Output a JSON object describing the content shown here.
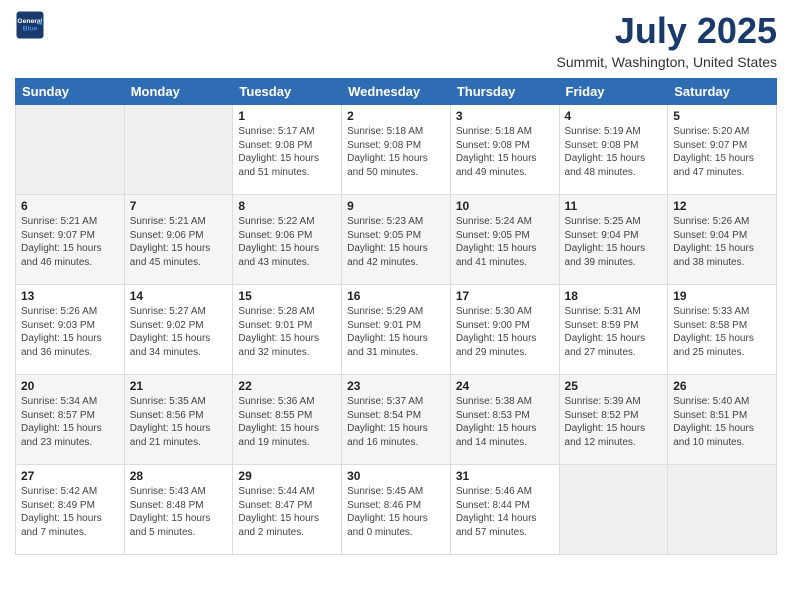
{
  "header": {
    "logo_line1": "General",
    "logo_line2": "Blue",
    "title": "July 2025",
    "subtitle": "Summit, Washington, United States"
  },
  "weekdays": [
    "Sunday",
    "Monday",
    "Tuesday",
    "Wednesday",
    "Thursday",
    "Friday",
    "Saturday"
  ],
  "weeks": [
    [
      {
        "day": "",
        "sunrise": "",
        "sunset": "",
        "daylight": ""
      },
      {
        "day": "",
        "sunrise": "",
        "sunset": "",
        "daylight": ""
      },
      {
        "day": "1",
        "sunrise": "Sunrise: 5:17 AM",
        "sunset": "Sunset: 9:08 PM",
        "daylight": "Daylight: 15 hours and 51 minutes."
      },
      {
        "day": "2",
        "sunrise": "Sunrise: 5:18 AM",
        "sunset": "Sunset: 9:08 PM",
        "daylight": "Daylight: 15 hours and 50 minutes."
      },
      {
        "day": "3",
        "sunrise": "Sunrise: 5:18 AM",
        "sunset": "Sunset: 9:08 PM",
        "daylight": "Daylight: 15 hours and 49 minutes."
      },
      {
        "day": "4",
        "sunrise": "Sunrise: 5:19 AM",
        "sunset": "Sunset: 9:08 PM",
        "daylight": "Daylight: 15 hours and 48 minutes."
      },
      {
        "day": "5",
        "sunrise": "Sunrise: 5:20 AM",
        "sunset": "Sunset: 9:07 PM",
        "daylight": "Daylight: 15 hours and 47 minutes."
      }
    ],
    [
      {
        "day": "6",
        "sunrise": "Sunrise: 5:21 AM",
        "sunset": "Sunset: 9:07 PM",
        "daylight": "Daylight: 15 hours and 46 minutes."
      },
      {
        "day": "7",
        "sunrise": "Sunrise: 5:21 AM",
        "sunset": "Sunset: 9:06 PM",
        "daylight": "Daylight: 15 hours and 45 minutes."
      },
      {
        "day": "8",
        "sunrise": "Sunrise: 5:22 AM",
        "sunset": "Sunset: 9:06 PM",
        "daylight": "Daylight: 15 hours and 43 minutes."
      },
      {
        "day": "9",
        "sunrise": "Sunrise: 5:23 AM",
        "sunset": "Sunset: 9:05 PM",
        "daylight": "Daylight: 15 hours and 42 minutes."
      },
      {
        "day": "10",
        "sunrise": "Sunrise: 5:24 AM",
        "sunset": "Sunset: 9:05 PM",
        "daylight": "Daylight: 15 hours and 41 minutes."
      },
      {
        "day": "11",
        "sunrise": "Sunrise: 5:25 AM",
        "sunset": "Sunset: 9:04 PM",
        "daylight": "Daylight: 15 hours and 39 minutes."
      },
      {
        "day": "12",
        "sunrise": "Sunrise: 5:26 AM",
        "sunset": "Sunset: 9:04 PM",
        "daylight": "Daylight: 15 hours and 38 minutes."
      }
    ],
    [
      {
        "day": "13",
        "sunrise": "Sunrise: 5:26 AM",
        "sunset": "Sunset: 9:03 PM",
        "daylight": "Daylight: 15 hours and 36 minutes."
      },
      {
        "day": "14",
        "sunrise": "Sunrise: 5:27 AM",
        "sunset": "Sunset: 9:02 PM",
        "daylight": "Daylight: 15 hours and 34 minutes."
      },
      {
        "day": "15",
        "sunrise": "Sunrise: 5:28 AM",
        "sunset": "Sunset: 9:01 PM",
        "daylight": "Daylight: 15 hours and 32 minutes."
      },
      {
        "day": "16",
        "sunrise": "Sunrise: 5:29 AM",
        "sunset": "Sunset: 9:01 PM",
        "daylight": "Daylight: 15 hours and 31 minutes."
      },
      {
        "day": "17",
        "sunrise": "Sunrise: 5:30 AM",
        "sunset": "Sunset: 9:00 PM",
        "daylight": "Daylight: 15 hours and 29 minutes."
      },
      {
        "day": "18",
        "sunrise": "Sunrise: 5:31 AM",
        "sunset": "Sunset: 8:59 PM",
        "daylight": "Daylight: 15 hours and 27 minutes."
      },
      {
        "day": "19",
        "sunrise": "Sunrise: 5:33 AM",
        "sunset": "Sunset: 8:58 PM",
        "daylight": "Daylight: 15 hours and 25 minutes."
      }
    ],
    [
      {
        "day": "20",
        "sunrise": "Sunrise: 5:34 AM",
        "sunset": "Sunset: 8:57 PM",
        "daylight": "Daylight: 15 hours and 23 minutes."
      },
      {
        "day": "21",
        "sunrise": "Sunrise: 5:35 AM",
        "sunset": "Sunset: 8:56 PM",
        "daylight": "Daylight: 15 hours and 21 minutes."
      },
      {
        "day": "22",
        "sunrise": "Sunrise: 5:36 AM",
        "sunset": "Sunset: 8:55 PM",
        "daylight": "Daylight: 15 hours and 19 minutes."
      },
      {
        "day": "23",
        "sunrise": "Sunrise: 5:37 AM",
        "sunset": "Sunset: 8:54 PM",
        "daylight": "Daylight: 15 hours and 16 minutes."
      },
      {
        "day": "24",
        "sunrise": "Sunrise: 5:38 AM",
        "sunset": "Sunset: 8:53 PM",
        "daylight": "Daylight: 15 hours and 14 minutes."
      },
      {
        "day": "25",
        "sunrise": "Sunrise: 5:39 AM",
        "sunset": "Sunset: 8:52 PM",
        "daylight": "Daylight: 15 hours and 12 minutes."
      },
      {
        "day": "26",
        "sunrise": "Sunrise: 5:40 AM",
        "sunset": "Sunset: 8:51 PM",
        "daylight": "Daylight: 15 hours and 10 minutes."
      }
    ],
    [
      {
        "day": "27",
        "sunrise": "Sunrise: 5:42 AM",
        "sunset": "Sunset: 8:49 PM",
        "daylight": "Daylight: 15 hours and 7 minutes."
      },
      {
        "day": "28",
        "sunrise": "Sunrise: 5:43 AM",
        "sunset": "Sunset: 8:48 PM",
        "daylight": "Daylight: 15 hours and 5 minutes."
      },
      {
        "day": "29",
        "sunrise": "Sunrise: 5:44 AM",
        "sunset": "Sunset: 8:47 PM",
        "daylight": "Daylight: 15 hours and 2 minutes."
      },
      {
        "day": "30",
        "sunrise": "Sunrise: 5:45 AM",
        "sunset": "Sunset: 8:46 PM",
        "daylight": "Daylight: 15 hours and 0 minutes."
      },
      {
        "day": "31",
        "sunrise": "Sunrise: 5:46 AM",
        "sunset": "Sunset: 8:44 PM",
        "daylight": "Daylight: 14 hours and 57 minutes."
      },
      {
        "day": "",
        "sunrise": "",
        "sunset": "",
        "daylight": ""
      },
      {
        "day": "",
        "sunrise": "",
        "sunset": "",
        "daylight": ""
      }
    ]
  ]
}
